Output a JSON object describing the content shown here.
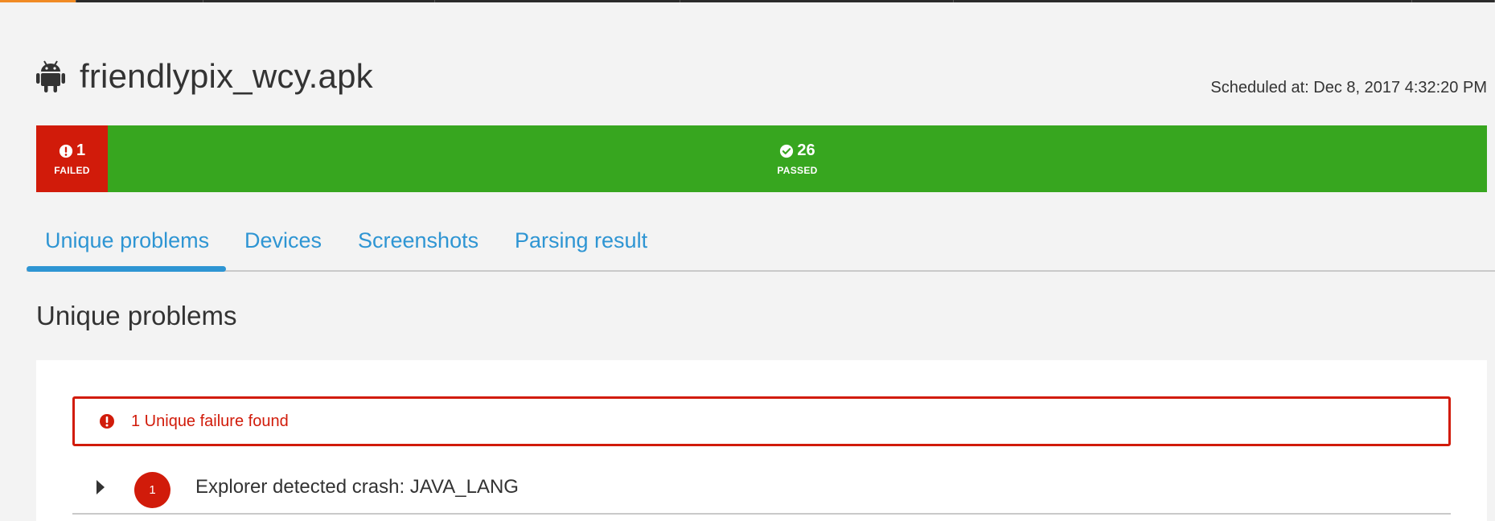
{
  "app": {
    "title": "friendlypix_wcy.apk",
    "scheduled": "Scheduled at: Dec 8, 2017 4:32:20 PM"
  },
  "summary": {
    "failed": {
      "count": "1",
      "label": "FAILED",
      "color": "#d11b0a"
    },
    "passed": {
      "count": "26",
      "label": "PASSED",
      "color": "#37a61f"
    }
  },
  "tabs": [
    {
      "label": "Unique problems",
      "active": true
    },
    {
      "label": "Devices",
      "active": false
    },
    {
      "label": "Screenshots",
      "active": false
    },
    {
      "label": "Parsing result",
      "active": false
    }
  ],
  "section": {
    "title": "Unique problems"
  },
  "alert": {
    "text": "1 Unique failure found",
    "icon": "exclamation-circle-icon"
  },
  "problems": [
    {
      "count": "1",
      "text": "Explorer detected crash: JAVA_LANG"
    }
  ],
  "colors": {
    "accent": "#2e95d3",
    "failed": "#d11b0a",
    "passed": "#37a61f",
    "top_active": "#f08a24"
  }
}
